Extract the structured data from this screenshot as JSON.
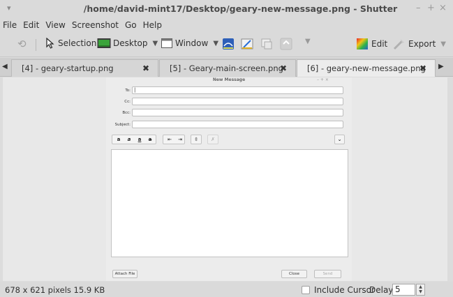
{
  "window": {
    "title": "/home/david-mint17/Desktop/geary-new-message.png - Shutter",
    "menu_glyph": "▾",
    "minimize": "–",
    "maximize": "+",
    "close": "×"
  },
  "menu": {
    "items": [
      "File",
      "Edit",
      "View",
      "Screenshot",
      "Go",
      "Help"
    ]
  },
  "toolbar": {
    "redo_icon": "⟲",
    "selection_label": "Selection",
    "desktop_label": "Desktop",
    "window_label": "Window",
    "edit_label": "Edit",
    "export_label": "Export",
    "dropdown_arrow": "▼"
  },
  "tabs": [
    {
      "label": "[4] - geary-startup.png",
      "close": "✖"
    },
    {
      "label": "[5] - Geary-main-screen.png",
      "close": "✖"
    },
    {
      "label": "[6] - geary-new-message.png",
      "close": "✖"
    }
  ],
  "tab_scroll": {
    "left": "◀",
    "right": "▶"
  },
  "screenshot": {
    "title": "New Message",
    "controls": "– + ×",
    "fields": [
      {
        "label": "To:",
        "value": "|"
      },
      {
        "label": "Cc:",
        "value": ""
      },
      {
        "label": "Bcc:",
        "value": ""
      },
      {
        "label": "Subject:",
        "value": ""
      }
    ],
    "format_buttons_a": [
      "a",
      "a",
      "a",
      "a"
    ],
    "format_buttons_b": [
      "⇤",
      "⇥"
    ],
    "format_buttons_c": [
      "⇳"
    ],
    "format_buttons_d": [
      "✗"
    ],
    "dropdown": "⌄",
    "attach_label": "Attach File",
    "close_label": "Close",
    "send_label": "Send"
  },
  "status": {
    "info": "678 x 621 pixels  15.9 KB",
    "include_cursor": "Include Cursor",
    "include_cursor_checked": false,
    "delay_label": "Delay:",
    "delay_value": "5",
    "spin_up": "▲",
    "spin_down": "▼"
  }
}
